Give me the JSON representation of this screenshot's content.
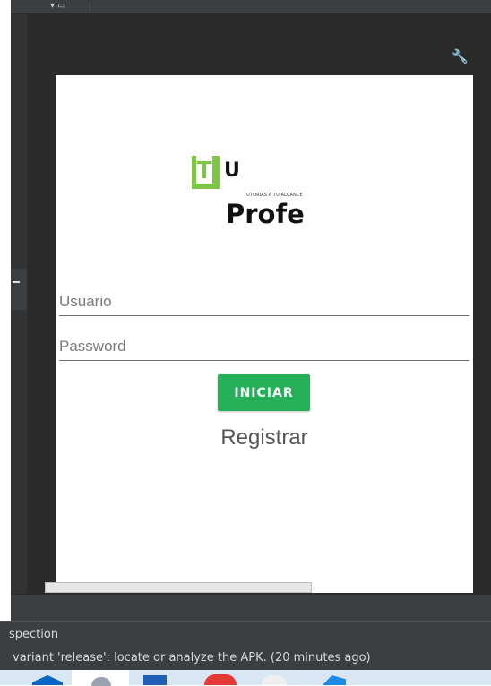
{
  "window": {
    "toolbar_icon": "▾ ▭"
  },
  "app_screen": {
    "logo": {
      "letter_t": "T",
      "letter_u": "U",
      "tagline": "TUTORIAS A TU ALCANCE",
      "wordmark": "Profe",
      "brand_color": "#7dc544"
    },
    "username": {
      "placeholder": "Usuario",
      "value": ""
    },
    "password": {
      "placeholder": "Password",
      "value": ""
    },
    "login_button": {
      "label": "INICIAR",
      "color": "#26b05a"
    },
    "register_link": "Registrar"
  },
  "status_bar": {
    "line1": "spection",
    "line2": "variant 'release': locate or analyze the APK. (20 minutes ago)"
  },
  "icons": {
    "wrench": "wrench-icon",
    "gutter": "collapse-marker-icon"
  }
}
